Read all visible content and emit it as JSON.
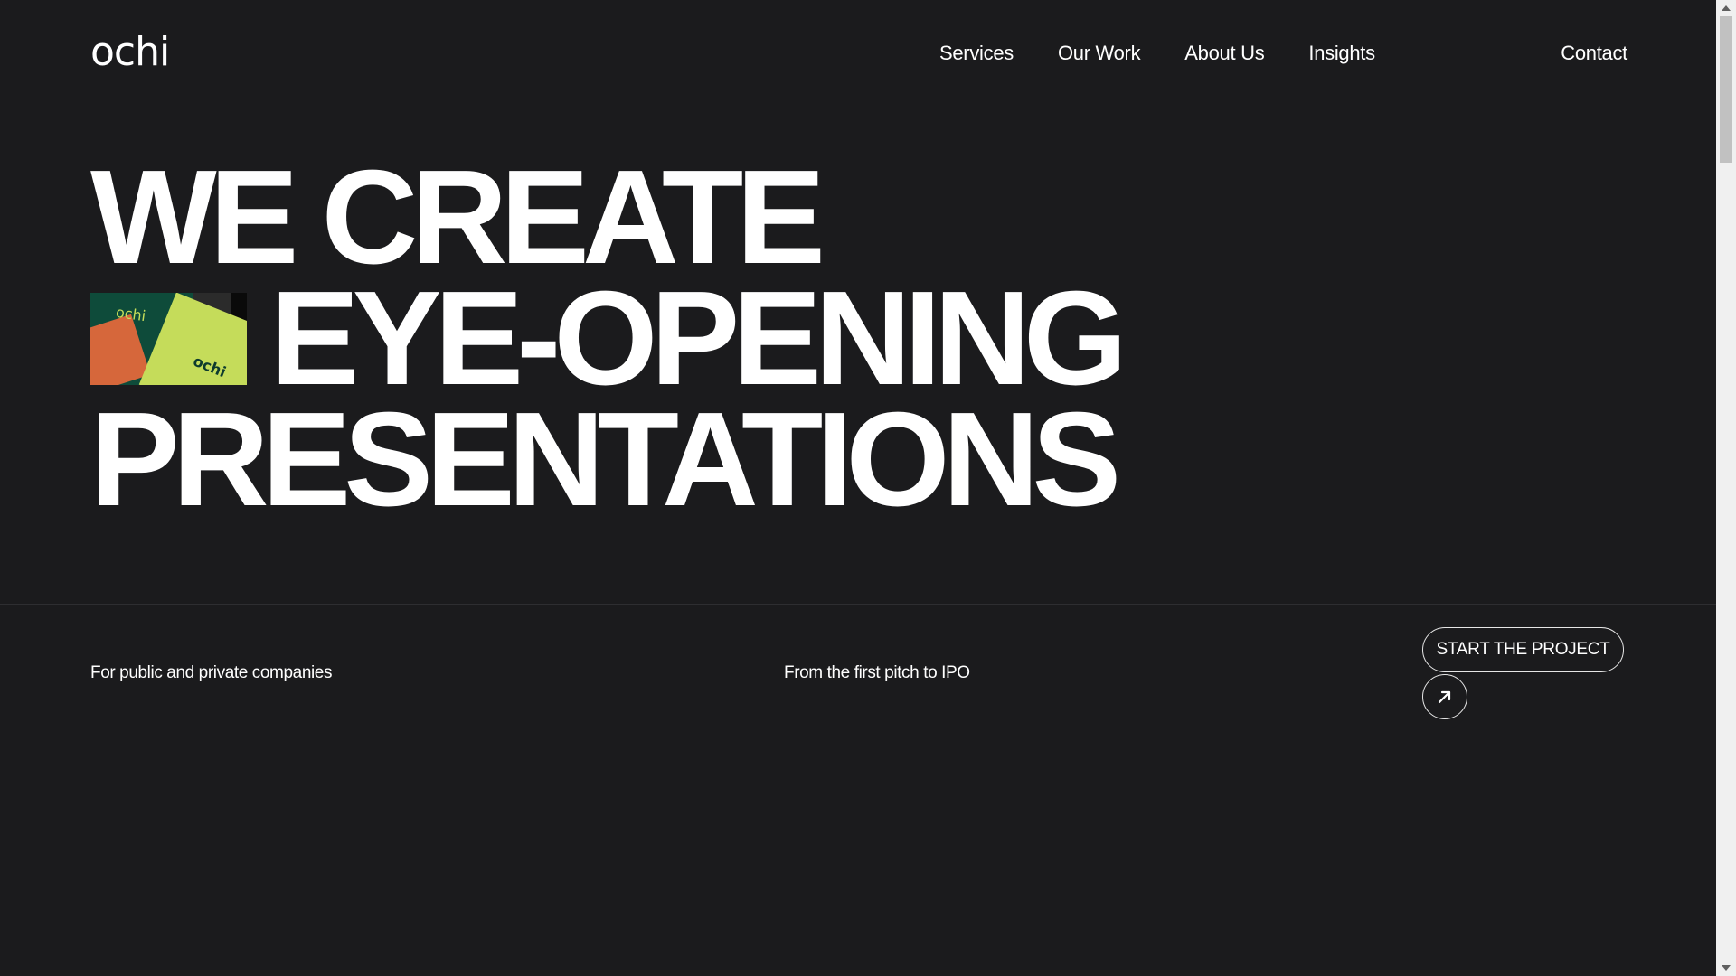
{
  "header": {
    "logo": "ochi",
    "nav": [
      "Services",
      "Our Work",
      "About Us",
      "Insights"
    ],
    "contact": "Contact"
  },
  "hero": {
    "line1": "WE CREATE",
    "line2": "EYE-OPENING",
    "line3": "PRESENTATIONS",
    "image_text_1": "ochi",
    "image_text_2": "ochi"
  },
  "sub": {
    "left": "For public and private companies",
    "middle": "From the first pitch to IPO"
  },
  "cta": {
    "label": "START THE PROJECT",
    "arrow_icon": "arrow-up-right-icon"
  },
  "colors": {
    "background": "#1b1b1d",
    "text": "#ffffff",
    "accent_lime": "#c5dc5a",
    "accent_green": "#0e4b3a",
    "accent_orange": "#d6673b"
  }
}
